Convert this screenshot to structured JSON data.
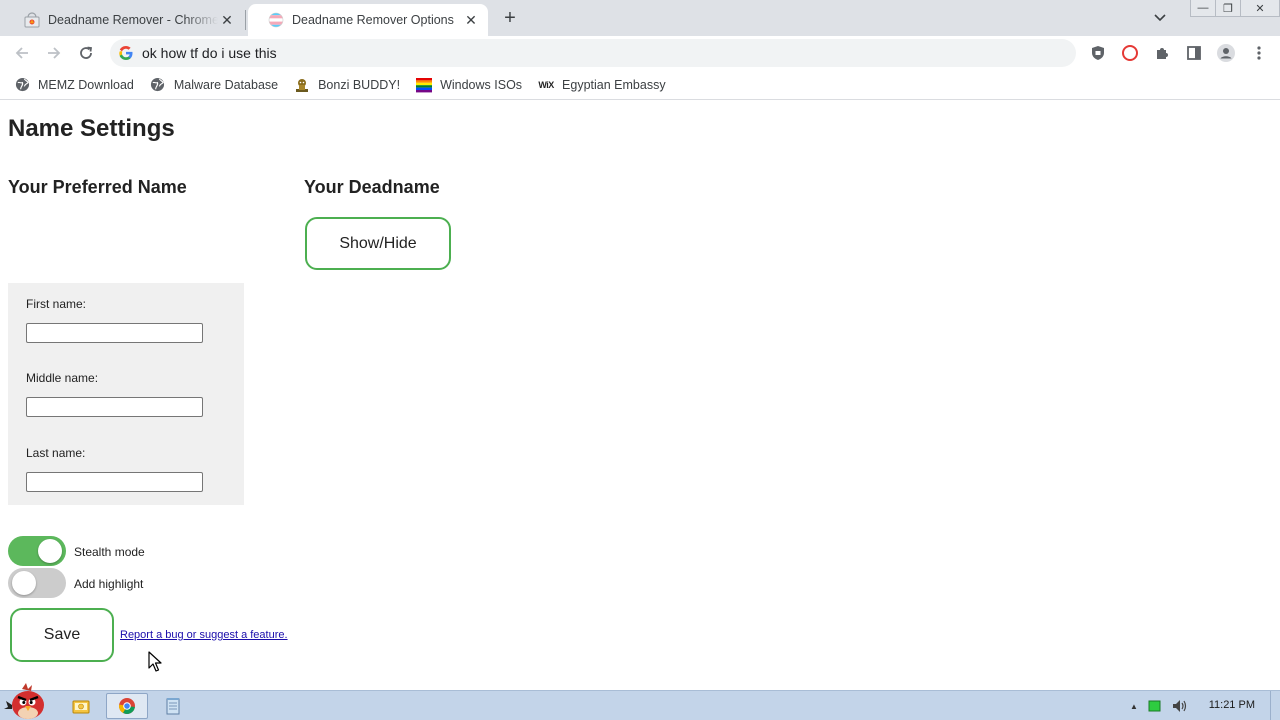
{
  "browser": {
    "tabs": [
      {
        "title": "Deadname Remover - Chrome W",
        "active": false
      },
      {
        "title": "Deadname Remover Options",
        "active": true
      }
    ],
    "new_tab": "+",
    "close_glyph": "✕",
    "window_buttons": {
      "minimize": "—",
      "restore": "❐",
      "close": "✕"
    },
    "address": "ok how tf do i use this",
    "bookmarks": [
      {
        "label": "MEMZ Download",
        "icon": "globe-icon"
      },
      {
        "label": "Malware Database",
        "icon": "globe-icon"
      },
      {
        "label": "Bonzi BUDDY!",
        "icon": "bonzi-icon"
      },
      {
        "label": "Windows ISOs",
        "icon": "windows-flag-icon"
      },
      {
        "label": "Egyptian Embassy",
        "icon": "wix-icon"
      }
    ],
    "wix_text": "WiX"
  },
  "page": {
    "title": "Name Settings",
    "preferred_heading": "Your Preferred Name",
    "deadname_heading": "Your Deadname",
    "show_hide_label": "Show/Hide",
    "fields": {
      "first_label": "First name:",
      "first_value": "",
      "middle_label": "Middle name:",
      "middle_value": "",
      "last_label": "Last name:",
      "last_value": ""
    },
    "toggles": {
      "stealth_label": "Stealth mode",
      "stealth_on": true,
      "highlight_label": "Add highlight",
      "highlight_on": false
    },
    "save_label": "Save",
    "report_link": "Report a bug or suggest a feature."
  },
  "taskbar": {
    "clock": "11:21 PM",
    "tray_up": "▲"
  },
  "colors": {
    "accent_green": "#4caf50",
    "toggle_on": "#5cb85c",
    "toggle_off": "#cccccc",
    "link": "#1a0dab",
    "taskbar": "#c3d4e9"
  }
}
